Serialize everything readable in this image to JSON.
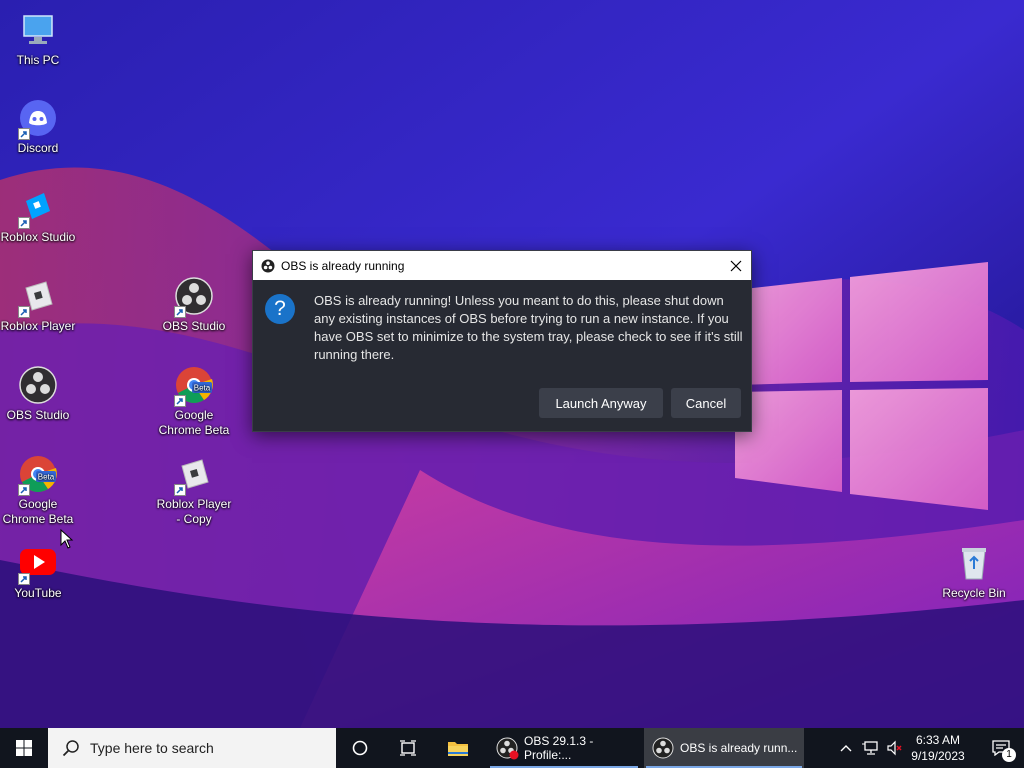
{
  "desktop": {
    "icons": [
      {
        "label": "This PC",
        "icon": "monitor-icon"
      },
      {
        "label": "Discord",
        "icon": "discord-icon"
      },
      {
        "label": "Roblox Studio",
        "icon": "roblox-studio-icon"
      },
      {
        "label": "Roblox Player",
        "icon": "roblox-icon"
      },
      {
        "label": "OBS Studio",
        "icon": "obs-icon"
      },
      {
        "label": "Google Chrome Beta",
        "icon": "chrome-beta-icon"
      },
      {
        "label": "YouTube",
        "icon": "youtube-icon"
      },
      {
        "label": "OBS Studio",
        "icon": "obs-icon"
      },
      {
        "label": "Google Chrome Beta",
        "icon": "chrome-beta-icon"
      },
      {
        "label": "Roblox Player - Copy",
        "icon": "roblox-icon"
      },
      {
        "label": "Recycle Bin",
        "icon": "recycle-bin-icon"
      }
    ],
    "chrome_badge": "Beta"
  },
  "dialog": {
    "title": "OBS is already running",
    "message": "OBS is already running! Unless you meant to do this, please shut down any existing instances of OBS before trying to run a new instance. If you have OBS set to minimize to the system tray, please check to see if it's still running there.",
    "question_mark": "?",
    "launch_label": "Launch Anyway",
    "cancel_label": "Cancel"
  },
  "taskbar": {
    "search_placeholder": "Type here to search",
    "apps": [
      {
        "label": "OBS 29.1.3 - Profile:..."
      },
      {
        "label": "OBS is already runn..."
      }
    ],
    "clock_time": "6:33 AM",
    "clock_date": "9/19/2023",
    "notification_count": "1"
  },
  "colors": {
    "accent": "#1a73c9",
    "dialog_bg": "#272a33",
    "button_bg": "#3b3f4a",
    "taskbar_bg": "#11151e"
  }
}
